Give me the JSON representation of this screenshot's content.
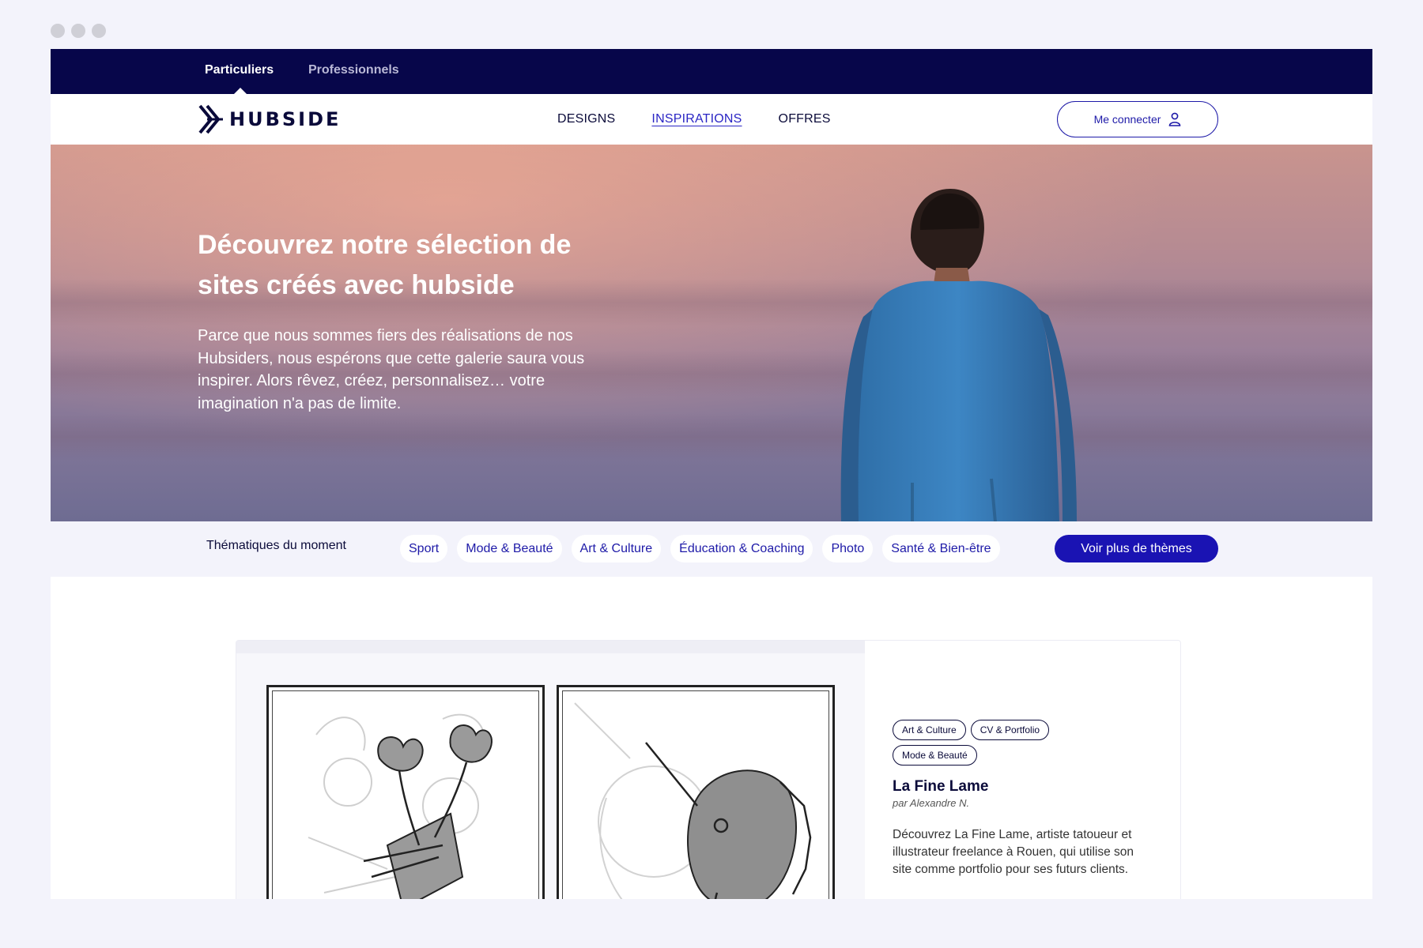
{
  "topbar": {
    "tab_individuals": "Particuliers",
    "tab_pros": "Professionnels"
  },
  "brand": {
    "name": "HUBSIDE"
  },
  "nav": {
    "designs": "DESIGNS",
    "inspirations": "INSPIRATIONS",
    "offers": "OFFRES",
    "login": "Me connecter"
  },
  "hero": {
    "title": "Découvrez notre sélection de sites créés avec hubside",
    "text": "Parce que nous sommes fiers des réalisations de nos Hubsiders, nous espérons que cette galerie saura vous inspirer. Alors rêvez, créez, personnalisez… votre imagination n'a pas de limite."
  },
  "themes": {
    "label": "Thématiques du moment",
    "chips": [
      "Sport",
      "Mode & Beauté",
      "Art & Culture",
      "Éducation & Coaching",
      "Photo",
      "Santé & Bien-être"
    ],
    "more": "Voir plus de thèmes"
  },
  "showcase": {
    "tags": [
      "Art & Culture",
      "CV & Portfolio",
      "Mode & Beauté"
    ],
    "title": "La Fine Lame",
    "author": "par Alexandre N.",
    "description": "Découvrez La Fine Lame, artiste tatoueur et illustrateur freelance à Rouen, qui utilise son site comme portfolio pour ses futurs clients."
  },
  "colors": {
    "navy": "#07064a",
    "accent": "#1a13b3",
    "page_bg": "#f3f3fb"
  },
  "icons": {
    "user": "user-icon",
    "logo": "hubside-logo-icon"
  }
}
